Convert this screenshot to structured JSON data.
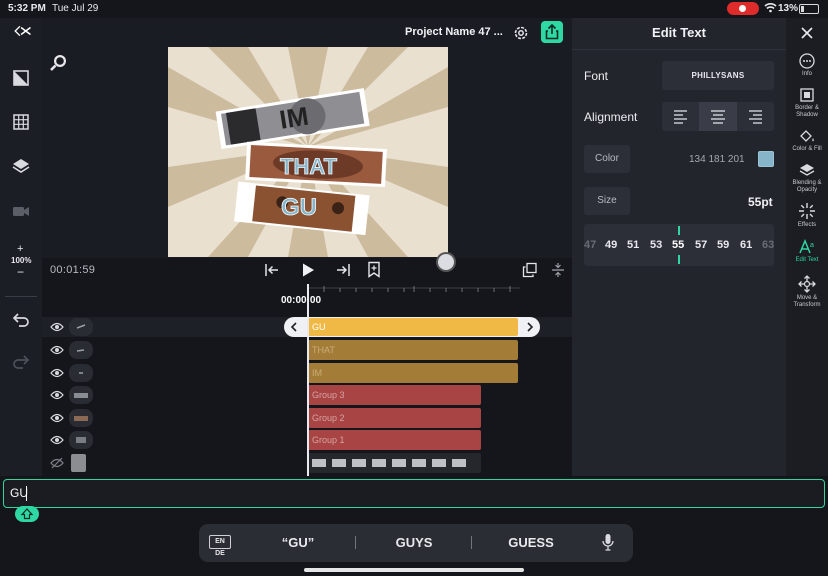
{
  "status_bar": {
    "time": "5:32 PM",
    "date": "Tue Jul 29",
    "battery": "13%"
  },
  "header": {
    "project_name": "Project Name 47 ..."
  },
  "player": {
    "timecode_current": "00:01:59",
    "timecode_playhead": "00:00:00",
    "preview_words": [
      "IM",
      "THAT",
      "GU"
    ]
  },
  "left_rail": {
    "zoom_plus": "+",
    "zoom_level": "100%",
    "zoom_minus": "−"
  },
  "tracks": [
    {
      "label": "GU",
      "selected": true
    },
    {
      "label": "THAT"
    },
    {
      "label": "IM"
    },
    {
      "label": "Group 3"
    },
    {
      "label": "Group 2"
    },
    {
      "label": "Group 1"
    },
    {
      "label": ""
    }
  ],
  "edit_panel": {
    "title": "Edit Text",
    "font_label": "Font",
    "font_value": "PHILLYSANS",
    "alignment_label": "Alignment",
    "color_label": "Color",
    "color_value": "134 181 201",
    "color_swatch": "#86b5c9",
    "size_label": "Size",
    "size_value": "55pt",
    "size_scale": [
      "47",
      "49",
      "51",
      "53",
      "55",
      "57",
      "59",
      "61",
      "63"
    ]
  },
  "tool_rail": [
    {
      "icon": "info-icon",
      "label": "Info"
    },
    {
      "icon": "border-shadow-icon",
      "label": "Border & Shadow"
    },
    {
      "icon": "color-fill-icon",
      "label": "Color & Fill"
    },
    {
      "icon": "blending-opacity-icon",
      "label": "Blending & Opacity"
    },
    {
      "icon": "effects-icon",
      "label": "Effects"
    },
    {
      "icon": "edit-text-icon",
      "label": "Edit Text"
    },
    {
      "icon": "move-transform-icon",
      "label": "Move & Transform"
    }
  ],
  "text_entry": {
    "value": "GU"
  },
  "keyboard": {
    "language": "EN DE",
    "suggestions": [
      "“GU”",
      "GUYS",
      "GUESS"
    ]
  },
  "colors": {
    "accent": "#2fd7a3",
    "gu_clip": "#f0b945",
    "word_clip": "#a37c37",
    "group_clip": "#a84443"
  }
}
